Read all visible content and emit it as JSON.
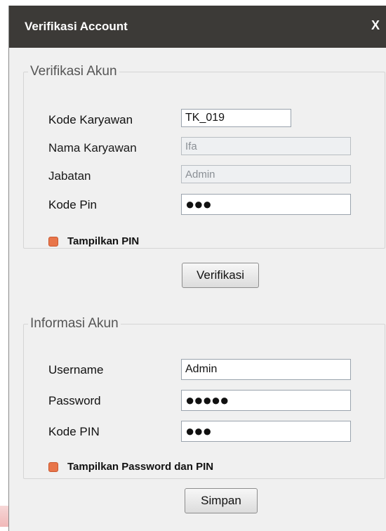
{
  "window": {
    "title": "Verifikasi Account",
    "close_label": "X"
  },
  "verifikasi": {
    "legend": "Verifikasi Akun",
    "kode_karyawan": {
      "label": "Kode Karyawan",
      "value": "TK_019"
    },
    "nama_karyawan": {
      "label": "Nama Karyawan",
      "value": "Ifa"
    },
    "jabatan": {
      "label": "Jabatan",
      "value": "Admin"
    },
    "kode_pin": {
      "label": "Kode Pin",
      "value": "●●●"
    },
    "show_pin": {
      "label": "Tampilkan PIN"
    },
    "button_label": "Verifikasi"
  },
  "informasi": {
    "legend": "Informasi Akun",
    "username": {
      "label": "Username",
      "value": "Admin"
    },
    "password": {
      "label": "Password",
      "value": "●●●●●"
    },
    "kode_pin": {
      "label": "Kode PIN",
      "value": "●●●"
    },
    "show_all": {
      "label": "Tampilkan Password dan PIN"
    },
    "button_label": "Simpan"
  },
  "colors": {
    "titlebar": "#3c3a37",
    "checkbox": "#e8754a"
  }
}
